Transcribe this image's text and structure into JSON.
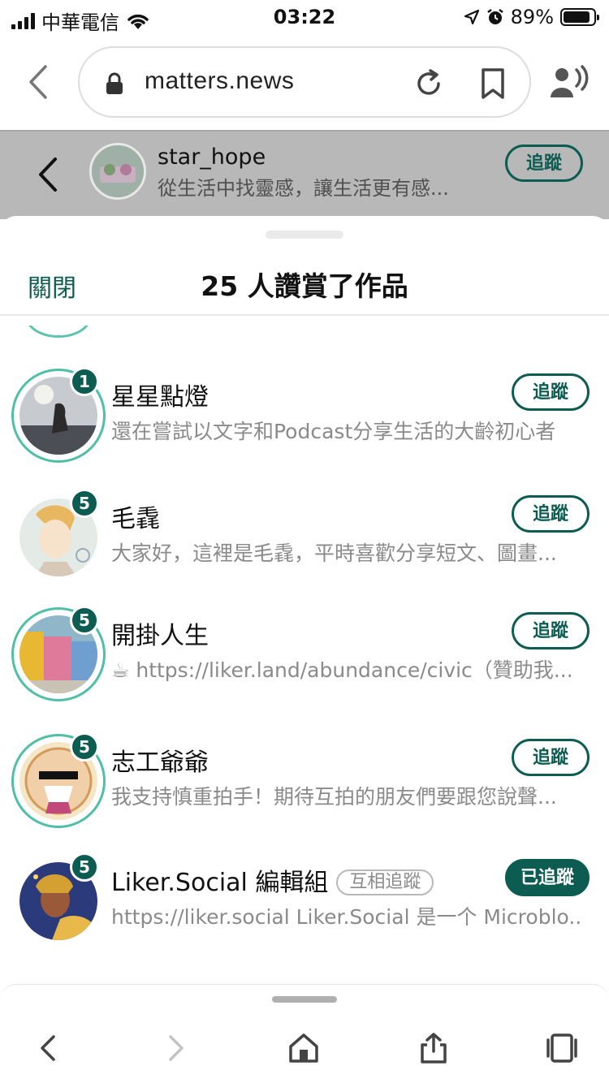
{
  "status_bar": {
    "carrier": "中華電信",
    "time": "03:22",
    "battery_percent": "89%",
    "battery_level": 0.89
  },
  "browser": {
    "url": "matters.news"
  },
  "page_header": {
    "author_name": "star_hope",
    "author_bio": "從生活中找靈感，讓生活更有感...",
    "follow_label": "追蹤"
  },
  "sheet": {
    "close_label": "關閉",
    "title": "25 人讚賞了作品"
  },
  "users": [
    {
      "name": "星星點燈",
      "count": "1",
      "bio": "還在嘗試以文字和Podcast分享生活的大齡初心者",
      "follow_label": "追蹤",
      "following": false,
      "ring": true,
      "mutual": ""
    },
    {
      "name": "毛毳",
      "count": "5",
      "bio": "大家好，這裡是毛毳，平時喜歡分享短文、圖畫...",
      "follow_label": "追蹤",
      "following": false,
      "ring": false,
      "mutual": ""
    },
    {
      "name": "開掛人生",
      "count": "5",
      "bio": "☕ https://liker.land/abundance/civic（贊助我...",
      "follow_label": "追蹤",
      "following": false,
      "ring": true,
      "mutual": ""
    },
    {
      "name": "志工爺爺",
      "count": "5",
      "bio": "我支持慎重拍手！期待互拍的朋友們要跟您說聲...",
      "follow_label": "追蹤",
      "following": false,
      "ring": true,
      "mutual": ""
    },
    {
      "name": "Liker.Social 編輯組",
      "count": "5",
      "bio": "https://liker.social Liker.Social 是一个 Microblo...",
      "follow_label": "已追蹤",
      "following": true,
      "ring": false,
      "mutual": "互相追蹤"
    }
  ],
  "icons": {
    "back": "chevron-left-icon",
    "lock": "lock-icon",
    "reload": "reload-icon",
    "bookmark": "bookmark-icon",
    "listen": "speaker-person-icon",
    "toolbar": [
      "back-icon",
      "forward-icon",
      "home-icon",
      "share-icon",
      "tabs-icon"
    ]
  },
  "colors": {
    "accent": "#0d5c52",
    "ring": "#4fbfa8",
    "muted_text": "#8a8a8a"
  }
}
